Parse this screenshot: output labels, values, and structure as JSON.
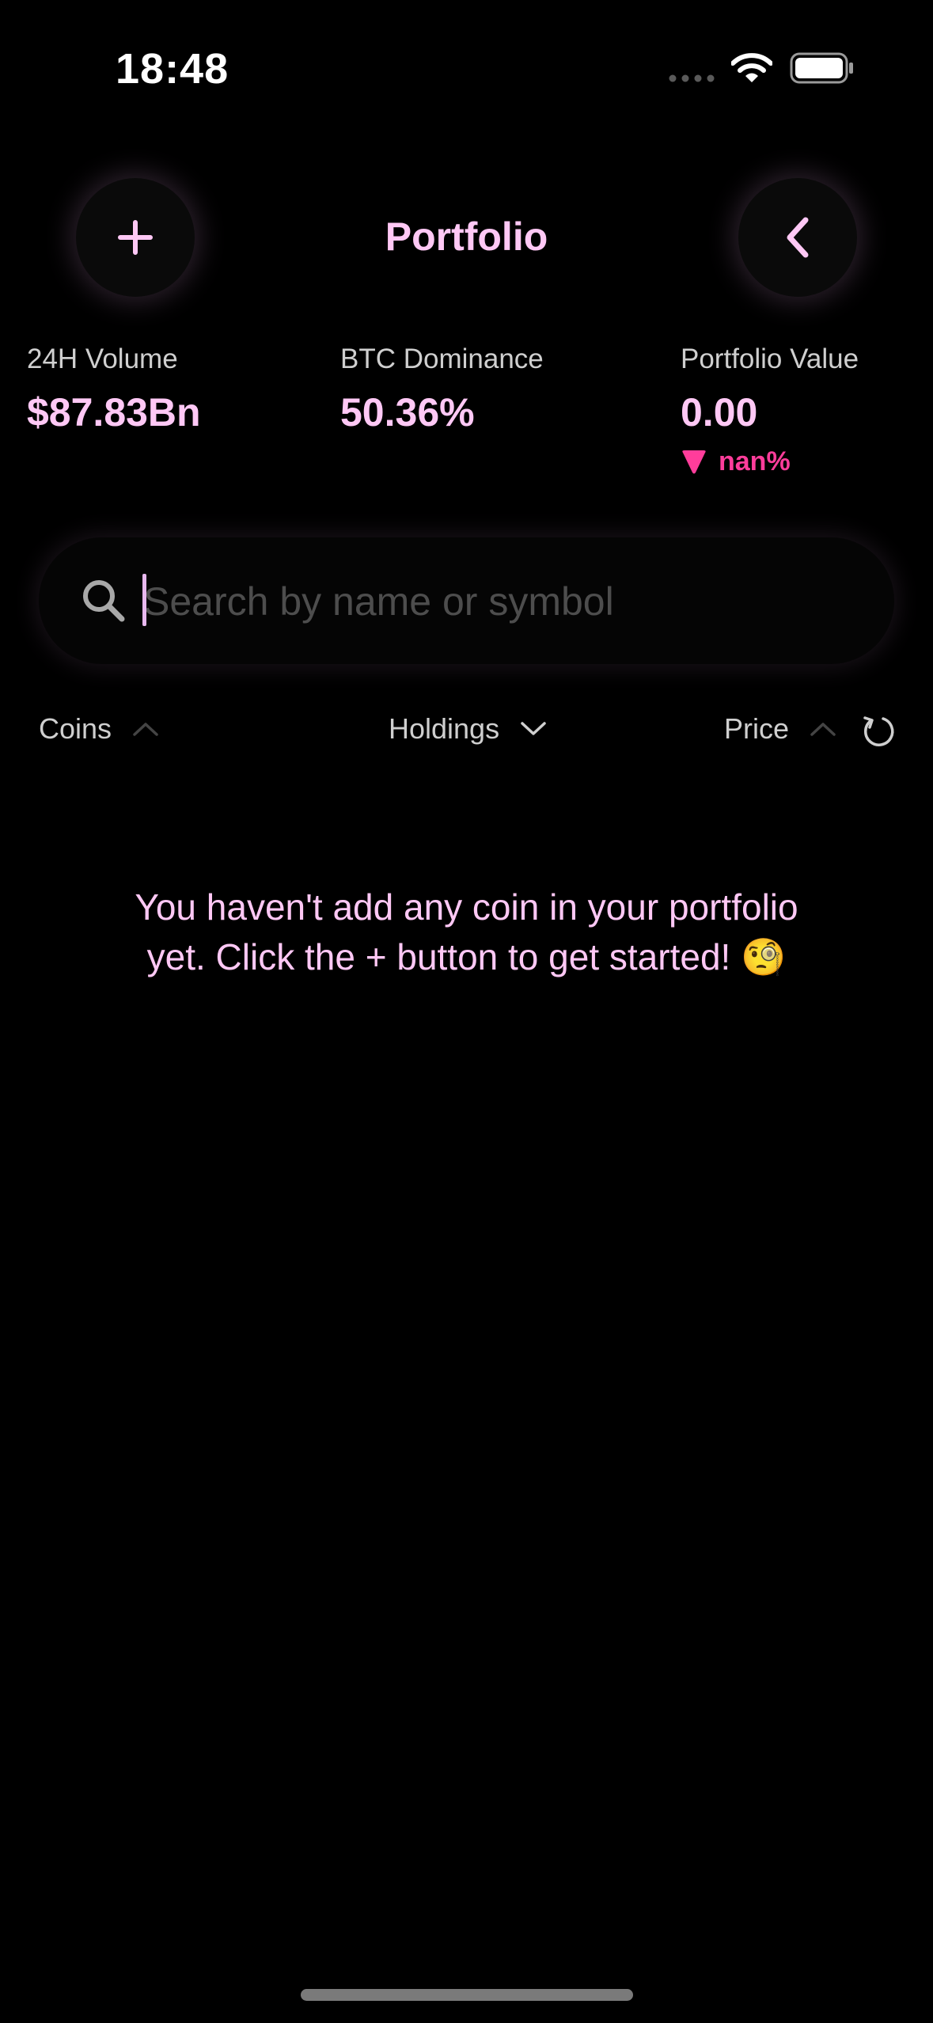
{
  "status_bar": {
    "time": "18:48"
  },
  "header": {
    "title": "Portfolio",
    "add_icon": "plus-icon",
    "back_icon": "chevron-left-icon"
  },
  "stats": {
    "volume": {
      "label": "24H Volume",
      "value": "$87.83Bn"
    },
    "dominance": {
      "label": "BTC Dominance",
      "value": "50.36%"
    },
    "portfolio": {
      "label": "Portfolio Value",
      "value": "0.00",
      "change": "nan%",
      "change_direction": "down"
    }
  },
  "search": {
    "placeholder": "Search by name or symbol",
    "value": ""
  },
  "columns": {
    "coins": {
      "label": "Coins",
      "sort_icon": "chevron-up-icon"
    },
    "holdings": {
      "label": "Holdings",
      "sort_icon": "chevron-down-icon"
    },
    "price": {
      "label": "Price",
      "sort_icon": "chevron-up-icon"
    },
    "reload_icon": "reload-icon"
  },
  "empty_state": {
    "message": "You haven't add any coin in your portfolio yet. Click the + button to get started! 🧐"
  },
  "colors": {
    "background": "#000000",
    "accent": "#ffc8f5",
    "negative": "#ff3d9b",
    "secondary_text": "#cfcfcf",
    "placeholder": "#4d4d4d"
  }
}
